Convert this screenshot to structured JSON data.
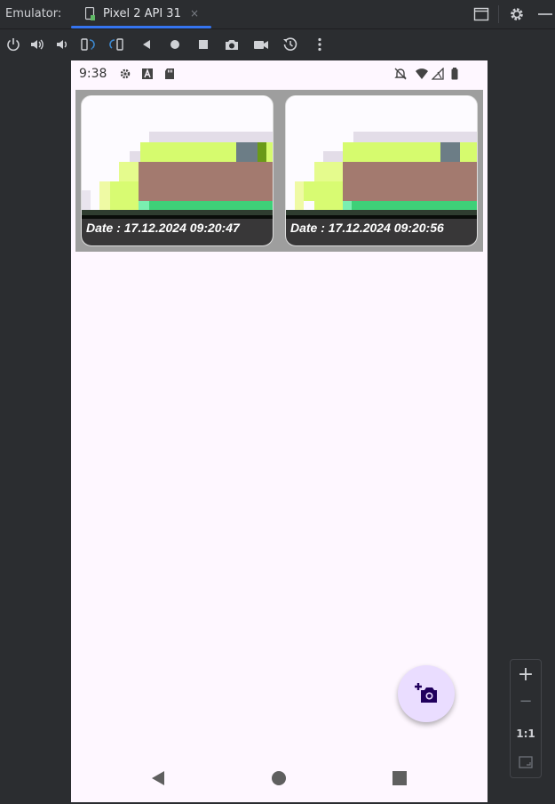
{
  "window": {
    "label": "Emulator:",
    "tab_label": "Pixel 2 API 31",
    "tab_close": "×"
  },
  "toolbar": {
    "icons": [
      "power-icon",
      "volume-up-icon",
      "volume-down-icon",
      "rotate-left-icon",
      "rotate-right-icon",
      "back-icon",
      "home-icon",
      "overview-icon",
      "screenshot-icon",
      "screen-record-icon",
      "snapshot-icon",
      "more-icon"
    ]
  },
  "status_bar": {
    "time": "9:38"
  },
  "gallery": {
    "items": [
      {
        "caption": "Date : 17.12.2024 09:20:47"
      },
      {
        "caption": "Date : 17.12.2024 09:20:56"
      }
    ]
  },
  "zoom": {
    "plus": "+",
    "minus": "−",
    "one_to_one": "1:1"
  },
  "colors": {
    "accent": "#3574f0",
    "fab_bg": "#eaddff",
    "fab_icon": "#21005d",
    "screen_bg": "#fef7ff"
  }
}
